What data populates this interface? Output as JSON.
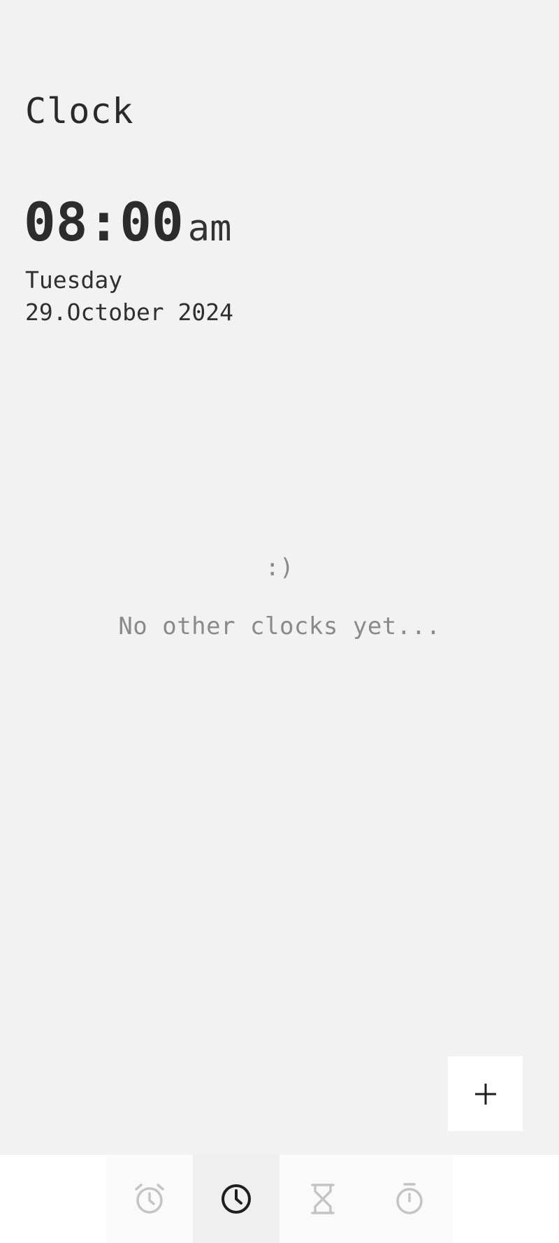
{
  "header": {
    "title": "Clock"
  },
  "clock": {
    "time": "08:00",
    "ampm": "am",
    "weekday": "Tuesday",
    "date": "29.October 2024"
  },
  "empty_state": {
    "emoticon": ":)",
    "message": "No other clocks yet..."
  },
  "fab": {
    "icon": "plus-icon"
  },
  "bottom_nav": {
    "items": [
      {
        "icon": "alarm-icon",
        "active": false
      },
      {
        "icon": "clock-icon",
        "active": true
      },
      {
        "icon": "hourglass-icon",
        "active": false
      },
      {
        "icon": "stopwatch-icon",
        "active": false
      }
    ]
  },
  "colors": {
    "background": "#f2f2f2",
    "text_primary": "#2a2a2a",
    "text_muted": "#8a8a8a",
    "nav_inactive_icon": "#c4c4c4",
    "nav_active_bg": "#efefef",
    "surface": "#ffffff"
  }
}
